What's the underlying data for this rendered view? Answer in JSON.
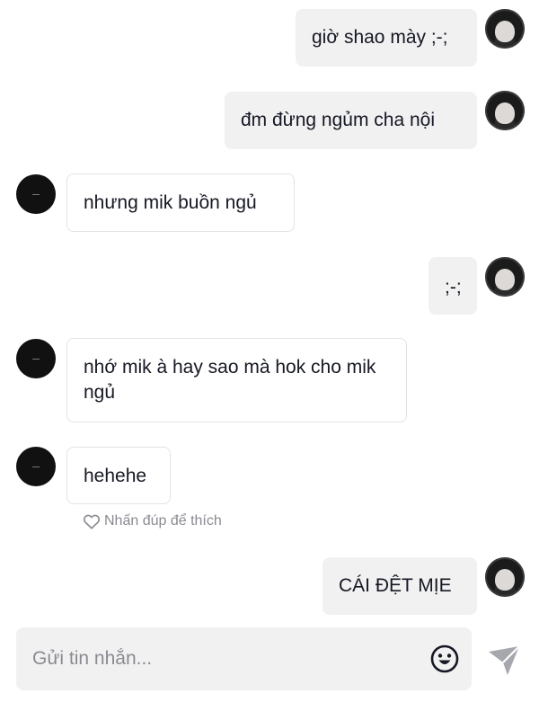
{
  "messages": [
    {
      "side": "out",
      "text": "giờ shao mày ;-;"
    },
    {
      "side": "out",
      "text": "đm đừng ngủm cha nội"
    },
    {
      "side": "in",
      "text": "nhưng mik buồn ngủ"
    },
    {
      "side": "out",
      "text": ";-;"
    },
    {
      "side": "in",
      "text": "nhớ mik à hay sao mà hok cho mik ngủ"
    },
    {
      "side": "in",
      "text": "hehehe"
    },
    {
      "side": "out",
      "text": "CÁI ĐỆT MỊE"
    }
  ],
  "like_hint": "Nhấn đúp để thích",
  "composer": {
    "placeholder": "Gửi tin nhắn...",
    "emoji_icon": "emoji-icon",
    "send_icon": "send-icon"
  },
  "colors": {
    "outgoing_bubble": "#f1f1f2",
    "incoming_border": "#e3e3e4",
    "placeholder": "#8a8b91"
  }
}
